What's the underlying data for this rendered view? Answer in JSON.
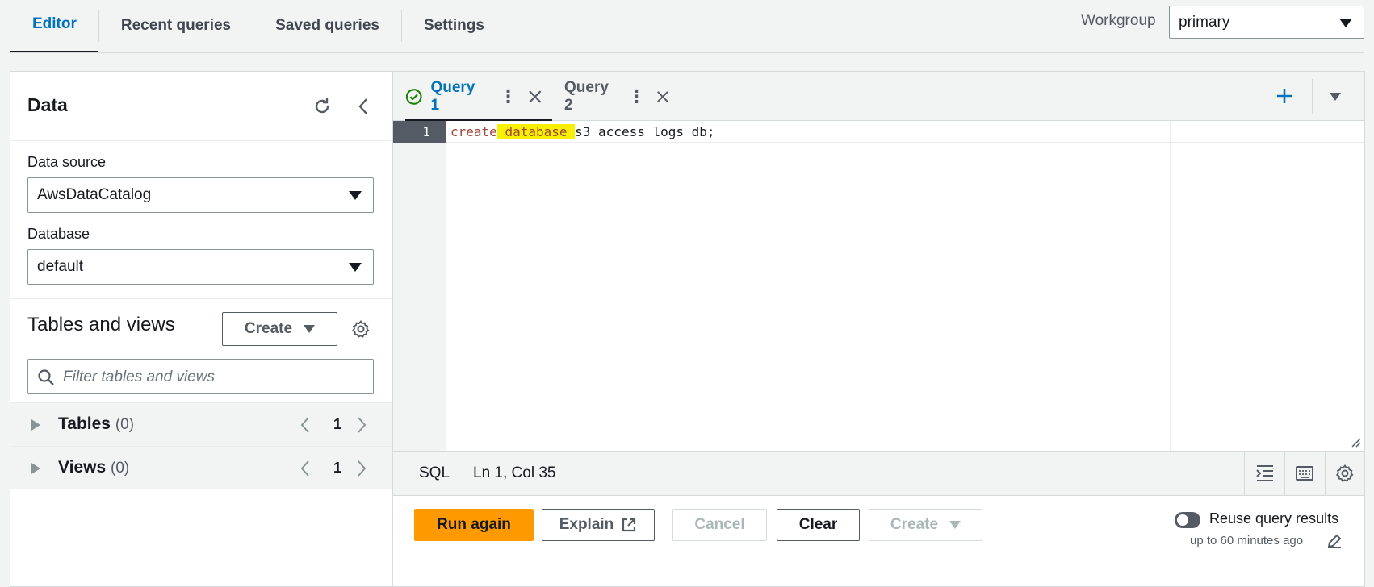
{
  "top_tabs": [
    {
      "label": "Editor",
      "active": true
    },
    {
      "label": "Recent queries",
      "active": false
    },
    {
      "label": "Saved queries",
      "active": false
    },
    {
      "label": "Settings",
      "active": false
    }
  ],
  "workgroup": {
    "label": "Workgroup",
    "value": "primary"
  },
  "data_panel": {
    "title": "Data",
    "refresh_icon": "refresh-icon",
    "collapse_icon": "chevron-left-icon",
    "data_source_label": "Data source",
    "data_source_value": "AwsDataCatalog",
    "database_label": "Database",
    "database_value": "default",
    "tables_views_title": "Tables and views",
    "create_label": "Create",
    "settings_icon": "gear-icon",
    "filter_placeholder": "Filter tables and views",
    "tables": {
      "label": "Tables",
      "count": "(0)",
      "page": "1"
    },
    "views": {
      "label": "Views",
      "count": "(0)",
      "page": "1"
    }
  },
  "query_tabs": [
    {
      "label": "Query 1",
      "active": true,
      "status": "success"
    },
    {
      "label": "Query 2",
      "active": false
    }
  ],
  "editor": {
    "line_number": "1",
    "code_kw1": "create",
    "code_kw2": "database",
    "code_rest": "s3_access_logs_db;"
  },
  "status_bar": {
    "language": "SQL",
    "position": "Ln 1, Col 35"
  },
  "actions": {
    "run": "Run again",
    "explain": "Explain",
    "cancel": "Cancel",
    "clear": "Clear",
    "create": "Create",
    "reuse_label": "Reuse query results",
    "reuse_sub": "up to 60 minutes ago"
  },
  "colors": {
    "accent": "#0073bb",
    "primary_button": "#ff9900",
    "highlight": "#f7f000",
    "success": "#1d8102"
  }
}
